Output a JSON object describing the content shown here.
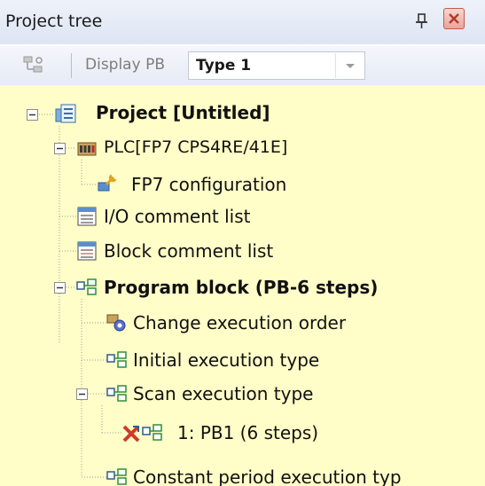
{
  "panel": {
    "title": "Project tree"
  },
  "toolbar": {
    "label": "Display PB",
    "combo_value": "Type 1"
  },
  "tree": {
    "project": "Project [Untitled]",
    "plc": "PLC[FP7 CPS4RE/41E]",
    "fp7_config": "FP7 configuration",
    "io_comment": "I/O comment list",
    "block_comment": "Block comment list",
    "program_block": "Program block (PB-6 steps)",
    "change_order": "Change execution order",
    "initial_exec": "Initial execution type",
    "scan_exec": "Scan execution type",
    "pb1": "1: PB1 (6 steps)",
    "constant_exec": "Constant period execution typ"
  },
  "colors": {
    "tree_background": "#fffdc8",
    "connector": "#a0a0a0"
  },
  "icons": {
    "pin": "pin-icon",
    "close": "close-icon",
    "toolbar": "tree-filter-icon",
    "dropdown": "chevron-down-icon",
    "project": "project-icon",
    "plc": "plc-unit-icon",
    "config": "configuration-wrench-icon",
    "io_comment": "io-comment-list-icon",
    "block_comment": "block-comment-list-icon",
    "program_block": "program-block-icon",
    "change_order": "change-order-gear-icon",
    "pb": "program-block-icon",
    "error": "error-x-icon"
  }
}
